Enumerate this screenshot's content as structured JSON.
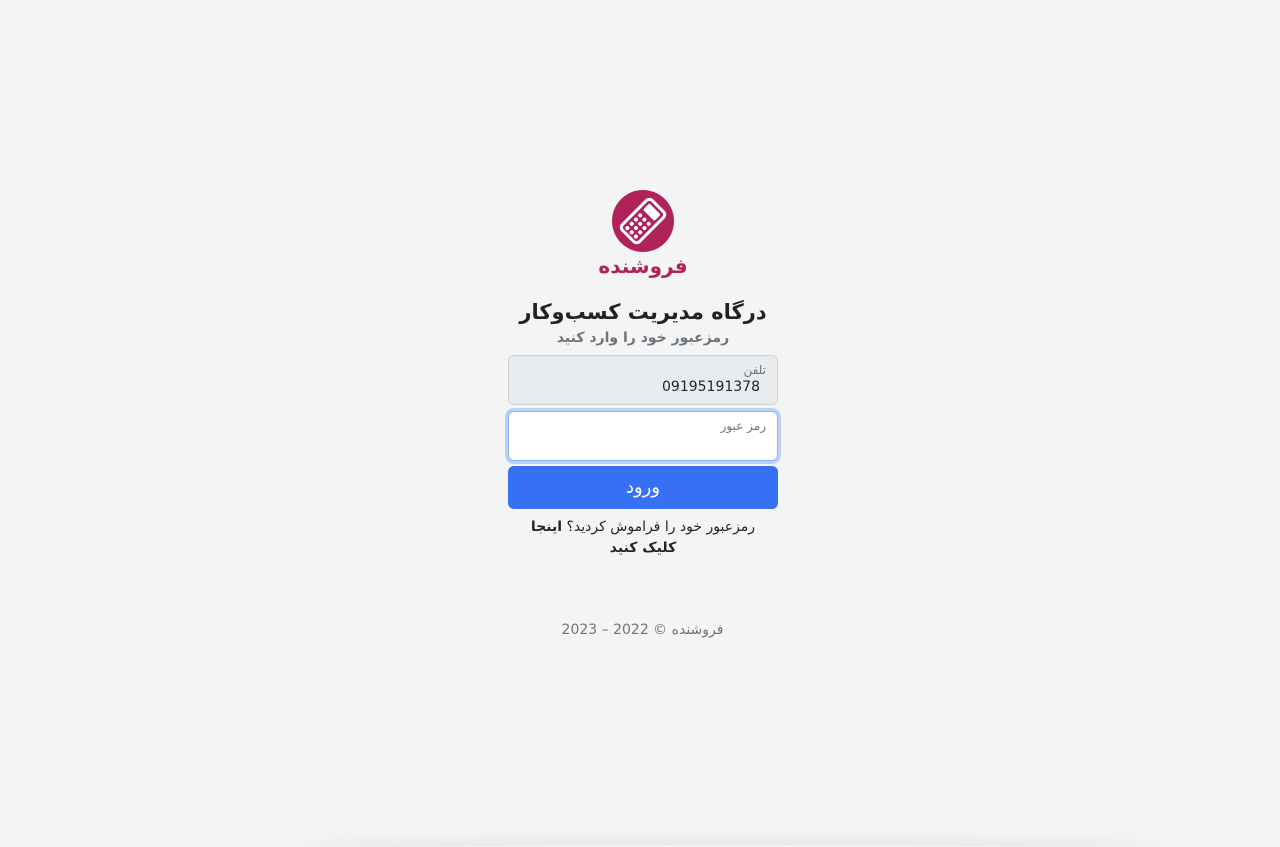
{
  "brand": {
    "name": "فروشنده",
    "color": "#b0235a",
    "logo_icon": "calculator-icon"
  },
  "header": {
    "title": "درگاه مدیریت کسب‌وکار",
    "subtitle": "رمزعبور خود را وارد کنید"
  },
  "form": {
    "phone_label": "تلفن",
    "phone_value": "09195191378",
    "password_label": "رمز عبور",
    "password_value": "",
    "submit_label": "ورود",
    "submit_color": "#3570f5"
  },
  "forgot": {
    "text": "رمزعبور خود را فراموش کردید؟",
    "link_text": "اینجا کلیک کنید"
  },
  "footer": {
    "text": "فروشنده © 2022 – 2023"
  }
}
